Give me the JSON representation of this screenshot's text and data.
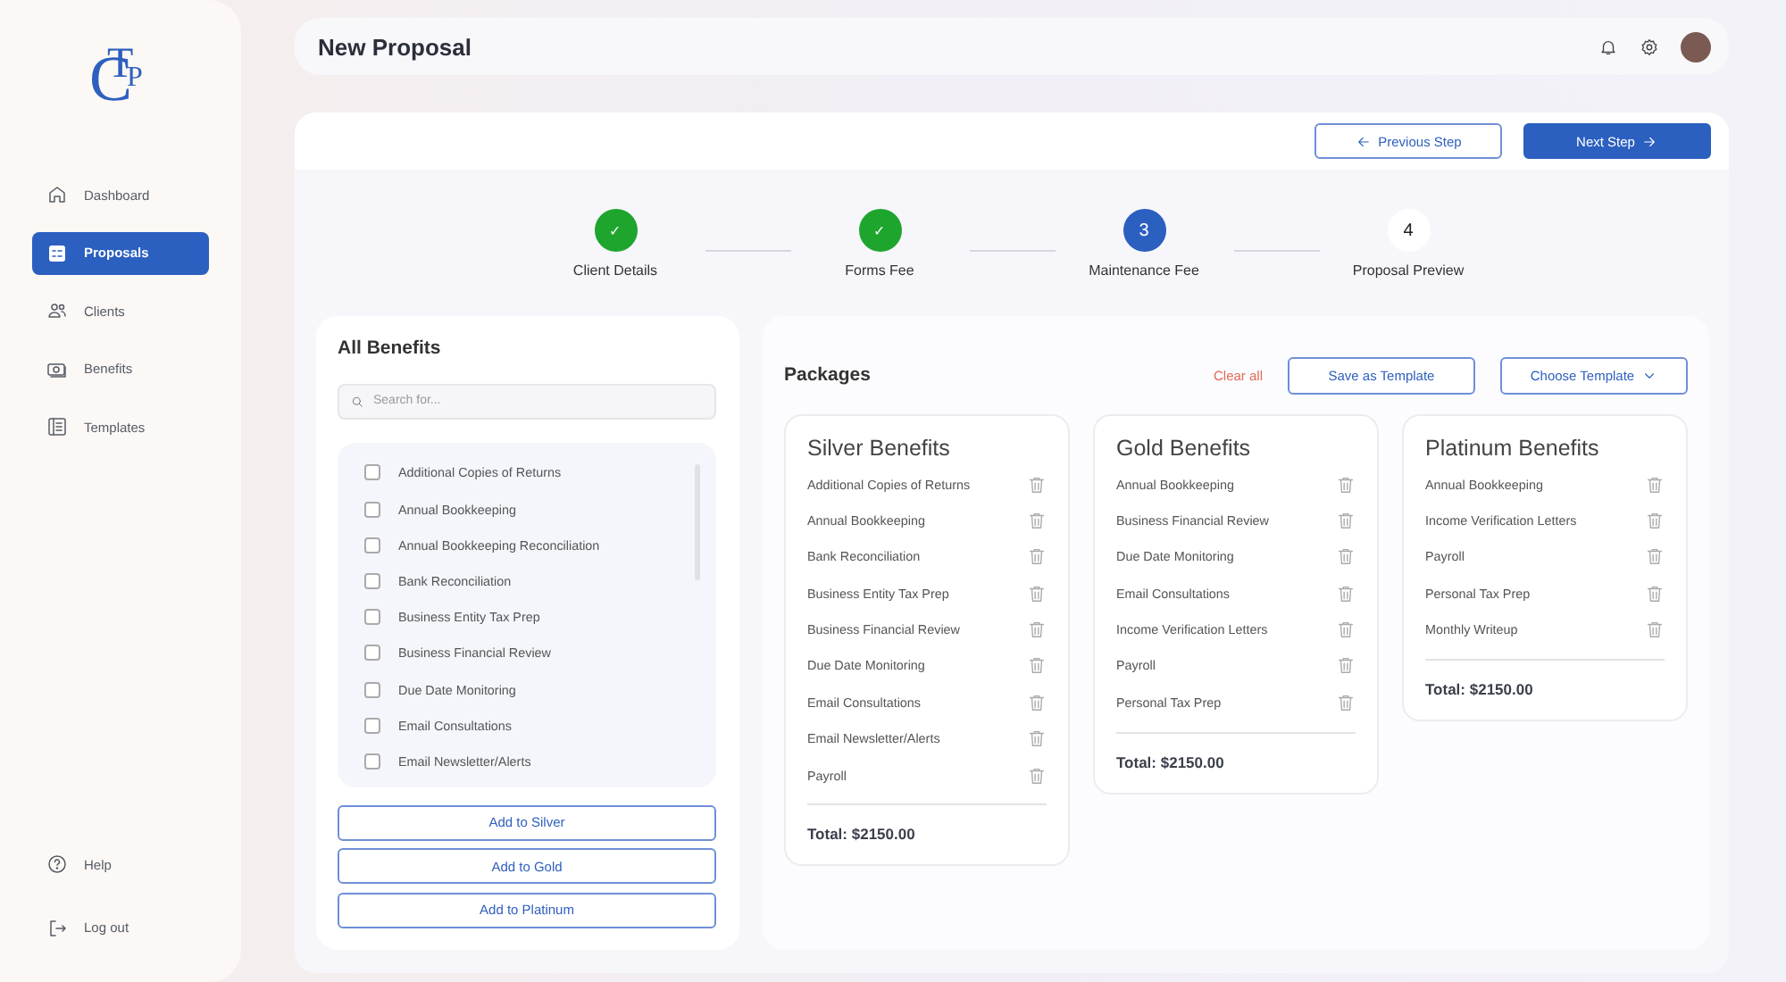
{
  "logo": {
    "letters": [
      "C",
      "T",
      "P"
    ]
  },
  "sidebar": {
    "items": [
      {
        "label": "Dashboard",
        "kind": "home",
        "selected": false
      },
      {
        "label": "Proposals",
        "kind": "proposals",
        "selected": true
      },
      {
        "label": "Clients",
        "kind": "clients",
        "selected": false
      },
      {
        "label": "Benefits",
        "kind": "benefits",
        "selected": false
      },
      {
        "label": "Templates",
        "kind": "templates",
        "selected": false
      }
    ],
    "bottom_items": [
      {
        "label": "Help",
        "kind": "help"
      },
      {
        "label": "Log out",
        "kind": "logout"
      }
    ]
  },
  "header": {
    "title": "New Proposal"
  },
  "toolbar": {
    "previous": "Previous Step",
    "next": "Next Step"
  },
  "steps": [
    {
      "label": "Client Details",
      "number": "✓",
      "kind": "done"
    },
    {
      "label": "Forms Fee",
      "number": "✓",
      "kind": "done"
    },
    {
      "label": "Maintenance Fee",
      "number": "3",
      "kind": "current"
    },
    {
      "label": "Proposal Preview",
      "number": "4",
      "kind": "upcoming"
    }
  ],
  "all_benefits": {
    "title": "All Benefits",
    "search": {
      "placeholder": "Search for..."
    },
    "items": [
      {
        "label": "Additional Copies of Returns",
        "checked": false
      },
      {
        "label": "Annual Bookkeeping",
        "checked": false
      },
      {
        "label": "Annual Bookkeeping Reconciliation",
        "checked": false
      },
      {
        "label": "Bank Reconciliation",
        "checked": false
      },
      {
        "label": "Business Entity Tax Prep",
        "checked": false
      },
      {
        "label": "Business Financial Review",
        "checked": false
      },
      {
        "label": "Due Date Monitoring",
        "checked": false
      },
      {
        "label": "Email Consultations",
        "checked": false
      },
      {
        "label": "Email Newsletter/Alerts",
        "checked": false
      }
    ],
    "buttons": [
      "Add to Silver",
      "Add to Gold",
      "Add to Platinum"
    ]
  },
  "packages": {
    "title": "Packages",
    "clear": "Clear all",
    "save": "Save as Template",
    "choose": "Choose Template",
    "cards": [
      {
        "title": "Silver Benefits",
        "items": [
          "Additional Copies of Returns",
          "Annual Bookkeeping",
          "Bank Reconciliation",
          "Business Entity Tax Prep",
          "Business Financial Review",
          "Due Date Monitoring",
          "Email Consultations",
          "Email Newsletter/Alerts",
          "Payroll"
        ],
        "total": "Total: $2150.00"
      },
      {
        "title": "Gold Benefits",
        "items": [
          "Annual Bookkeeping",
          "Business Financial Review",
          "Due Date Monitoring",
          "Email Consultations",
          "Income Verification Letters",
          "Payroll",
          "Personal Tax Prep"
        ],
        "total": "Total: $2150.00"
      },
      {
        "title": "Platinum Benefits",
        "items": [
          "Annual Bookkeeping",
          "Income Verification Letters",
          "Payroll",
          "Personal Tax Prep",
          "Monthly Writeup"
        ],
        "total": "Total: $2150.00"
      }
    ]
  }
}
